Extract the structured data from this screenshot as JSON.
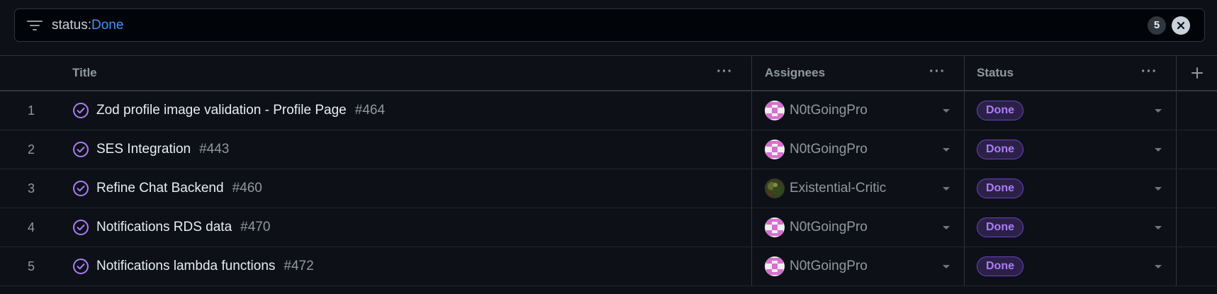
{
  "filter": {
    "key": "status:",
    "value": "Done",
    "count": "5"
  },
  "columns": {
    "title": "Title",
    "assignees": "Assignees",
    "status": "Status"
  },
  "rows": [
    {
      "num": "1",
      "title": "Zod profile image validation - Profile Page",
      "issue": "#464",
      "assignee": "N0tGoingPro",
      "avatar": "pink-identicon",
      "status": "Done"
    },
    {
      "num": "2",
      "title": "SES Integration",
      "issue": "#443",
      "assignee": "N0tGoingPro",
      "avatar": "pink-identicon",
      "status": "Done"
    },
    {
      "num": "3",
      "title": "Refine Chat Backend",
      "issue": "#460",
      "assignee": "Existential-Critic",
      "avatar": "photo",
      "status": "Done"
    },
    {
      "num": "4",
      "title": "Notifications RDS data",
      "issue": "#470",
      "assignee": "N0tGoingPro",
      "avatar": "pink-identicon",
      "status": "Done"
    },
    {
      "num": "5",
      "title": "Notifications lambda functions",
      "issue": "#472",
      "assignee": "N0tGoingPro",
      "avatar": "pink-identicon",
      "status": "Done"
    }
  ],
  "colors": {
    "accent": "#4493f8",
    "done_purple": "#ab7df8",
    "background": "#0d1117"
  }
}
